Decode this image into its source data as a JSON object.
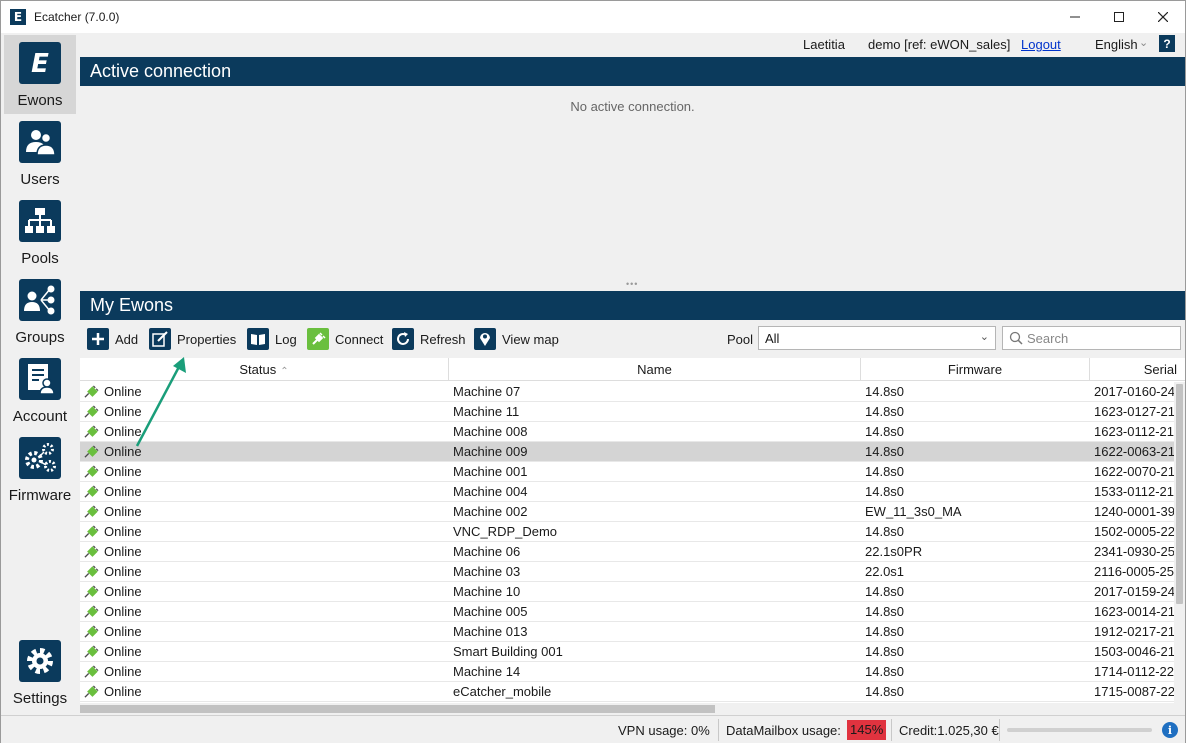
{
  "window": {
    "title": "Ecatcher (7.0.0)",
    "app_icon_letter": "E"
  },
  "userbar": {
    "user": "Laetitia",
    "account": "demo [ref: eWON_sales]",
    "logout": "Logout",
    "language": "English",
    "help": "?"
  },
  "sidebar": {
    "items": [
      {
        "label": "Ewons",
        "icon": "ewon-logo-icon",
        "active": true
      },
      {
        "label": "Users",
        "icon": "users-icon"
      },
      {
        "label": "Pools",
        "icon": "pools-hierarchy-icon"
      },
      {
        "label": "Groups",
        "icon": "groups-icon"
      },
      {
        "label": "Account",
        "icon": "account-icon"
      },
      {
        "label": "Firmware",
        "icon": "firmware-gears-icon"
      }
    ],
    "settings": {
      "label": "Settings",
      "icon": "settings-gear-icon"
    }
  },
  "active_connection": {
    "title": "Active connection",
    "empty_message": "No active connection."
  },
  "my_ewons": {
    "title": "My Ewons",
    "toolbar": {
      "add": "Add",
      "properties": "Properties",
      "log": "Log",
      "connect": "Connect",
      "refresh": "Refresh",
      "view_map": "View map",
      "pool_label": "Pool",
      "pool_value": "All",
      "search_placeholder": "Search"
    },
    "columns": {
      "status": "Status",
      "name": "Name",
      "firmware": "Firmware",
      "serial": "Serial"
    },
    "rows": [
      {
        "status": "Online",
        "name": "Machine 07",
        "firmware": "14.8s0",
        "serial": "2017-0160-24"
      },
      {
        "status": "Online",
        "name": "Machine 11",
        "firmware": "14.8s0",
        "serial": "1623-0127-21"
      },
      {
        "status": "Online",
        "name": "Machine 008",
        "firmware": "14.8s0",
        "serial": "1623-0112-21"
      },
      {
        "status": "Online",
        "name": "Machine 009",
        "firmware": "14.8s0",
        "serial": "1622-0063-21",
        "selected": true
      },
      {
        "status": "Online",
        "name": "Machine 001",
        "firmware": "14.8s0",
        "serial": "1622-0070-21"
      },
      {
        "status": "Online",
        "name": "Machine 004",
        "firmware": "14.8s0",
        "serial": "1533-0112-21"
      },
      {
        "status": "Online",
        "name": "Machine 002",
        "firmware": "EW_11_3s0_MA",
        "serial": "1240-0001-39"
      },
      {
        "status": "Online",
        "name": "VNC_RDP_Demo",
        "firmware": "14.8s0",
        "serial": "1502-0005-22"
      },
      {
        "status": "Online",
        "name": "Machine 06",
        "firmware": "22.1s0PR",
        "serial": "2341-0930-25"
      },
      {
        "status": "Online",
        "name": "Machine 03",
        "firmware": "22.0s1",
        "serial": "2116-0005-25"
      },
      {
        "status": "Online",
        "name": "Machine 10",
        "firmware": "14.8s0",
        "serial": "2017-0159-24"
      },
      {
        "status": "Online",
        "name": "Machine 005",
        "firmware": "14.8s0",
        "serial": "1623-0014-21"
      },
      {
        "status": "Online",
        "name": "Machine 013",
        "firmware": "14.8s0",
        "serial": "1912-0217-21"
      },
      {
        "status": "Online",
        "name": "Smart Building 001",
        "firmware": "14.8s0",
        "serial": "1503-0046-21"
      },
      {
        "status": "Online",
        "name": "Machine 14",
        "firmware": "14.8s0",
        "serial": "1714-0112-22"
      },
      {
        "status": "Online",
        "name": "eCatcher_mobile",
        "firmware": "14.8s0",
        "serial": "1715-0087-22"
      }
    ]
  },
  "statusbar": {
    "vpn_usage": "VPN usage:  0%",
    "datamailbox_label": "DataMailbox usage:",
    "datamailbox_value": "145%",
    "credit": "Credit:1.025,30 €"
  },
  "colors": {
    "brand_navy": "#0b3a5c",
    "online_green": "#6abf3e",
    "alert_red": "#e0333f",
    "annotation_arrow": "#1a9e7a"
  }
}
